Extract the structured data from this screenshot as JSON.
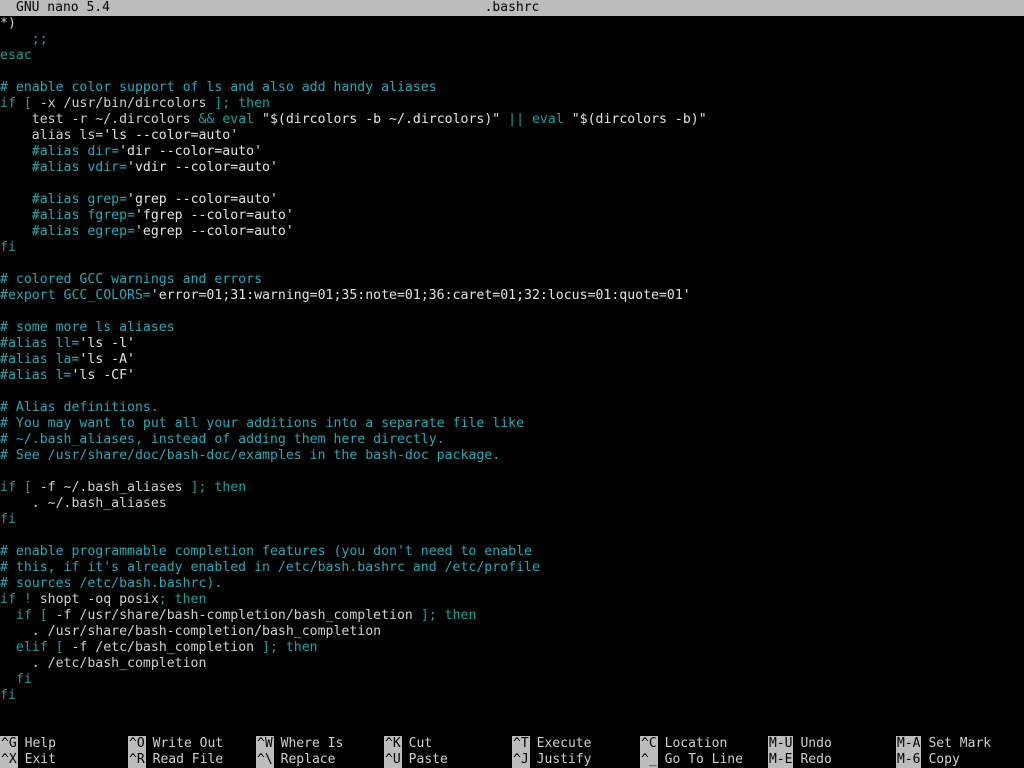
{
  "title_bar": {
    "app": "GNU nano 5.4",
    "filename": ".bashrc"
  },
  "editor": {
    "lines": [
      [
        {
          "t": "*)",
          "c": "default"
        }
      ],
      [
        {
          "t": "    ;;",
          "c": "op"
        }
      ],
      [
        {
          "t": "esac",
          "c": "keyword"
        }
      ],
      [
        {
          "t": "",
          "c": "default"
        }
      ],
      [
        {
          "t": "# enable color support of ls and also add handy aliases",
          "c": "comment"
        }
      ],
      [
        {
          "t": "if [ ",
          "c": "keyword"
        },
        {
          "t": "-x",
          "c": "flag"
        },
        {
          "t": " /usr/bin/dircolors ",
          "c": "default"
        },
        {
          "t": "]; then",
          "c": "keyword"
        }
      ],
      [
        {
          "t": "    test ",
          "c": "default"
        },
        {
          "t": "-r",
          "c": "flag"
        },
        {
          "t": " ~/.dircolors ",
          "c": "default"
        },
        {
          "t": "&& eval",
          "c": "keyword"
        },
        {
          "t": " \"$(dircolors -b ~/.dircolors)\" ",
          "c": "string"
        },
        {
          "t": "|| eval",
          "c": "keyword"
        },
        {
          "t": " \"$(dircolors -b)\"",
          "c": "string"
        }
      ],
      [
        {
          "t": "    alias ls=",
          "c": "default"
        },
        {
          "t": "'ls --color=auto'",
          "c": "string"
        }
      ],
      [
        {
          "t": "    #alias dir=",
          "c": "comment"
        },
        {
          "t": "'dir --color=auto'",
          "c": "string"
        }
      ],
      [
        {
          "t": "    #alias vdir=",
          "c": "comment"
        },
        {
          "t": "'vdir --color=auto'",
          "c": "string"
        }
      ],
      [
        {
          "t": "",
          "c": "default"
        }
      ],
      [
        {
          "t": "    #alias grep=",
          "c": "comment"
        },
        {
          "t": "'grep --color=auto'",
          "c": "string"
        }
      ],
      [
        {
          "t": "    #alias fgrep=",
          "c": "comment"
        },
        {
          "t": "'fgrep --color=auto'",
          "c": "string"
        }
      ],
      [
        {
          "t": "    #alias egrep=",
          "c": "comment"
        },
        {
          "t": "'egrep --color=auto'",
          "c": "string"
        }
      ],
      [
        {
          "t": "fi",
          "c": "keyword"
        }
      ],
      [
        {
          "t": "",
          "c": "default"
        }
      ],
      [
        {
          "t": "# colored GCC warnings and errors",
          "c": "comment"
        }
      ],
      [
        {
          "t": "#export GCC_COLORS=",
          "c": "comment"
        },
        {
          "t": "'error=01;31:warning=01;35:note=01;36:caret=01;32:locus=01:quote=01'",
          "c": "string"
        }
      ],
      [
        {
          "t": "",
          "c": "default"
        }
      ],
      [
        {
          "t": "# some more ls aliases",
          "c": "comment"
        }
      ],
      [
        {
          "t": "#alias ll=",
          "c": "comment"
        },
        {
          "t": "'ls -l'",
          "c": "string"
        }
      ],
      [
        {
          "t": "#alias la=",
          "c": "comment"
        },
        {
          "t": "'ls -A'",
          "c": "string"
        }
      ],
      [
        {
          "t": "#alias l=",
          "c": "comment"
        },
        {
          "t": "'ls -CF'",
          "c": "string"
        }
      ],
      [
        {
          "t": "",
          "c": "default"
        }
      ],
      [
        {
          "t": "# Alias definitions.",
          "c": "comment"
        }
      ],
      [
        {
          "t": "# You may want to put all your additions into a separate file like",
          "c": "comment"
        }
      ],
      [
        {
          "t": "# ~/.bash_aliases, instead of adding them here directly.",
          "c": "comment"
        }
      ],
      [
        {
          "t": "# See /usr/share/doc/bash-doc/examples in the bash-doc package.",
          "c": "comment"
        }
      ],
      [
        {
          "t": "",
          "c": "default"
        }
      ],
      [
        {
          "t": "if [ ",
          "c": "keyword"
        },
        {
          "t": "-f",
          "c": "flag"
        },
        {
          "t": " ~/.bash_aliases ",
          "c": "default"
        },
        {
          "t": "]; then",
          "c": "keyword"
        }
      ],
      [
        {
          "t": "    . ~/.bash_aliases",
          "c": "default"
        }
      ],
      [
        {
          "t": "fi",
          "c": "keyword"
        }
      ],
      [
        {
          "t": "",
          "c": "default"
        }
      ],
      [
        {
          "t": "# enable programmable completion features (you don't need to enable",
          "c": "comment"
        }
      ],
      [
        {
          "t": "# this, if it's already enabled in /etc/bash.bashrc and /etc/profile",
          "c": "comment"
        }
      ],
      [
        {
          "t": "# sources /etc/bash.bashrc).",
          "c": "comment"
        }
      ],
      [
        {
          "t": "if ! ",
          "c": "keyword"
        },
        {
          "t": "shopt -oq posix",
          "c": "default"
        },
        {
          "t": "; then",
          "c": "keyword"
        }
      ],
      [
        {
          "t": "  if [ ",
          "c": "keyword"
        },
        {
          "t": "-f",
          "c": "flag"
        },
        {
          "t": " /usr/share/bash-completion/bash_completion ",
          "c": "default"
        },
        {
          "t": "]; then",
          "c": "keyword"
        }
      ],
      [
        {
          "t": "    . /usr/share/bash-completion/bash_completion",
          "c": "default"
        }
      ],
      [
        {
          "t": "  elif [ ",
          "c": "keyword"
        },
        {
          "t": "-f",
          "c": "flag"
        },
        {
          "t": " /etc/bash_completion ",
          "c": "default"
        },
        {
          "t": "]; then",
          "c": "keyword"
        }
      ],
      [
        {
          "t": "    . /etc/bash_completion",
          "c": "default"
        }
      ],
      [
        {
          "t": "  fi",
          "c": "keyword"
        }
      ],
      [
        {
          "t": "fi",
          "c": "keyword"
        }
      ]
    ]
  },
  "shortcuts": [
    {
      "key": "^G",
      "label": "Help",
      "row": 0,
      "col": 0
    },
    {
      "key": "^X",
      "label": "Exit",
      "row": 1,
      "col": 0
    },
    {
      "key": "^O",
      "label": "Write Out",
      "row": 0,
      "col": 1
    },
    {
      "key": "^R",
      "label": "Read File",
      "row": 1,
      "col": 1
    },
    {
      "key": "^W",
      "label": "Where Is",
      "row": 0,
      "col": 2
    },
    {
      "key": "^\\",
      "label": "Replace",
      "row": 1,
      "col": 2
    },
    {
      "key": "^K",
      "label": "Cut",
      "row": 0,
      "col": 3
    },
    {
      "key": "^U",
      "label": "Paste",
      "row": 1,
      "col": 3
    },
    {
      "key": "^T",
      "label": "Execute",
      "row": 0,
      "col": 4
    },
    {
      "key": "^J",
      "label": "Justify",
      "row": 1,
      "col": 4
    },
    {
      "key": "^C",
      "label": "Location",
      "row": 0,
      "col": 5
    },
    {
      "key": "^_",
      "label": "Go To Line",
      "row": 1,
      "col": 5
    },
    {
      "key": "M-U",
      "label": "Undo",
      "row": 0,
      "col": 6
    },
    {
      "key": "M-E",
      "label": "Redo",
      "row": 1,
      "col": 6
    },
    {
      "key": "M-A",
      "label": "Set Mark",
      "row": 0,
      "col": 7
    },
    {
      "key": "M-6",
      "label": "Copy",
      "row": 1,
      "col": 7
    }
  ]
}
